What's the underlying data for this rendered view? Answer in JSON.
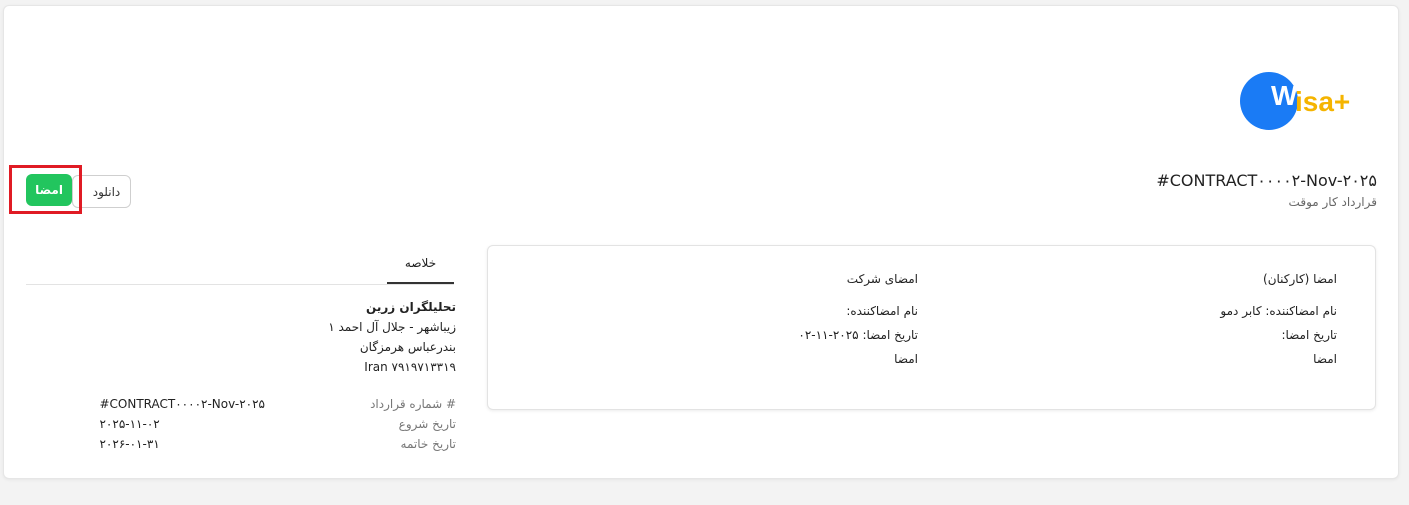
{
  "logo": {
    "letter_w": "W",
    "rest": "isa+"
  },
  "header": {
    "title": "#CONTRACT۰۰۰۰۲-Nov-۲۰۲۵",
    "subtitle": "قرارداد کار موقت"
  },
  "actions": {
    "sign_label": "امضا",
    "download_label": "دانلود"
  },
  "signatures": {
    "employee": {
      "heading": "امضا (کارکنان)",
      "signer_name": "نام امضاکننده: کابر دمو",
      "sign_date": "تاریخ امضا:",
      "signature": "امضا"
    },
    "company": {
      "heading": "امضای شرکت",
      "signer_name": "نام امضاکننده:",
      "sign_date": "تاریخ امضا: ۲۰۲۵-۱۱-۰۲",
      "signature": "امضا"
    }
  },
  "summary": {
    "tab_label": "خلاصه",
    "address": {
      "company": "تحلیلگران زرین",
      "line1": "زیباشهر - جلال آل احمد ۱",
      "line2": "بندرعباس هرمزگان",
      "line3": "Iran ۷۹۱۹۷۱۳۳۱۹"
    },
    "fields": {
      "contract_number_label": "# شماره قرارداد",
      "contract_number_value": "#CONTRACT۰۰۰۰۲-Nov-۲۰۲۵",
      "start_date_label": "تاریخ شروع",
      "start_date_value": "۲۰۲۵-۱۱-۰۲",
      "end_date_label": "تاریخ خاتمه",
      "end_date_value": "۲۰۲۶-۰۱-۳۱"
    }
  },
  "colors": {
    "sign_button": "#22c55e",
    "logo_blue": "#1a7bf5",
    "logo_yellow": "#f5b400",
    "highlight": "#e01b24"
  }
}
